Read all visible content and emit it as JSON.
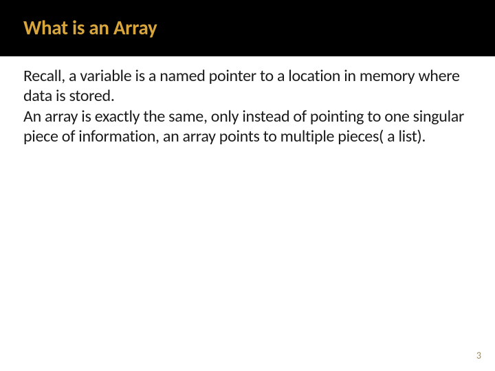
{
  "slide": {
    "title": "What is an Array",
    "paragraph1": "Recall, a variable is a named pointer to a location in memory where data is stored.",
    "paragraph2": "An array is exactly the same, only instead of pointing to one singular piece of information, an array points to multiple pieces( a list).",
    "pageNumber": "3"
  },
  "colors": {
    "headerBg": "#000000",
    "titleColor": "#d9a63c",
    "bodyColor": "#1a1a1a",
    "pageNumColor": "#9b8a6a"
  }
}
